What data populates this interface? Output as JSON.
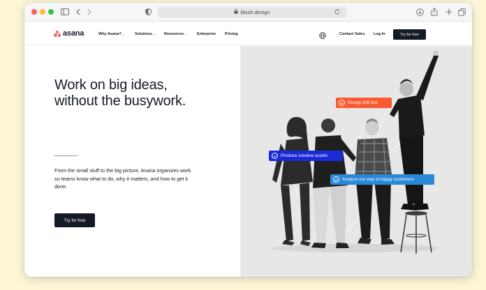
{
  "browser": {
    "url": "blush.design"
  },
  "nav": {
    "logo_text": "asana",
    "items": [
      {
        "label": "Why Asana?",
        "caret": true
      },
      {
        "label": "Solutions",
        "caret": true
      },
      {
        "label": "Resources",
        "caret": true
      },
      {
        "label": "Enterprise",
        "caret": false
      },
      {
        "label": "Pricing",
        "caret": false
      }
    ],
    "contact_sales": "Contact Sales",
    "log_in": "Log In",
    "cta": "Try for free"
  },
  "hero": {
    "headline_line1": "Work on big ideas,",
    "headline_line2": "without the busywork.",
    "body": "From the small stuff to the big picture, Asana organizes work so teams know what to do, why it matters, and how to get it done.",
    "cta": "Try for free",
    "tags": {
      "design": "Design A/B test",
      "produce": "Produce creative assets",
      "analyze": "Analyze our way to happy customers"
    }
  },
  "colors": {
    "brand_dark": "#151b26",
    "logo_coral": "#f06a6a",
    "tag_orange": "#f95b31",
    "tag_navy": "#1a2ad6",
    "tag_blue": "#2b88d8",
    "page_background": "#fdf7d8"
  },
  "icons": {
    "sidebar": "sidebar-icon",
    "back": "chevron-left-icon",
    "forward": "chevron-right-icon",
    "shield": "shield-icon",
    "lock": "lock-icon",
    "reload": "reload-icon",
    "download": "download-icon",
    "share": "share-icon",
    "new_tab": "plus-icon",
    "tabs": "tabs-icon",
    "globe": "globe-icon",
    "check": "check-circle-icon"
  }
}
